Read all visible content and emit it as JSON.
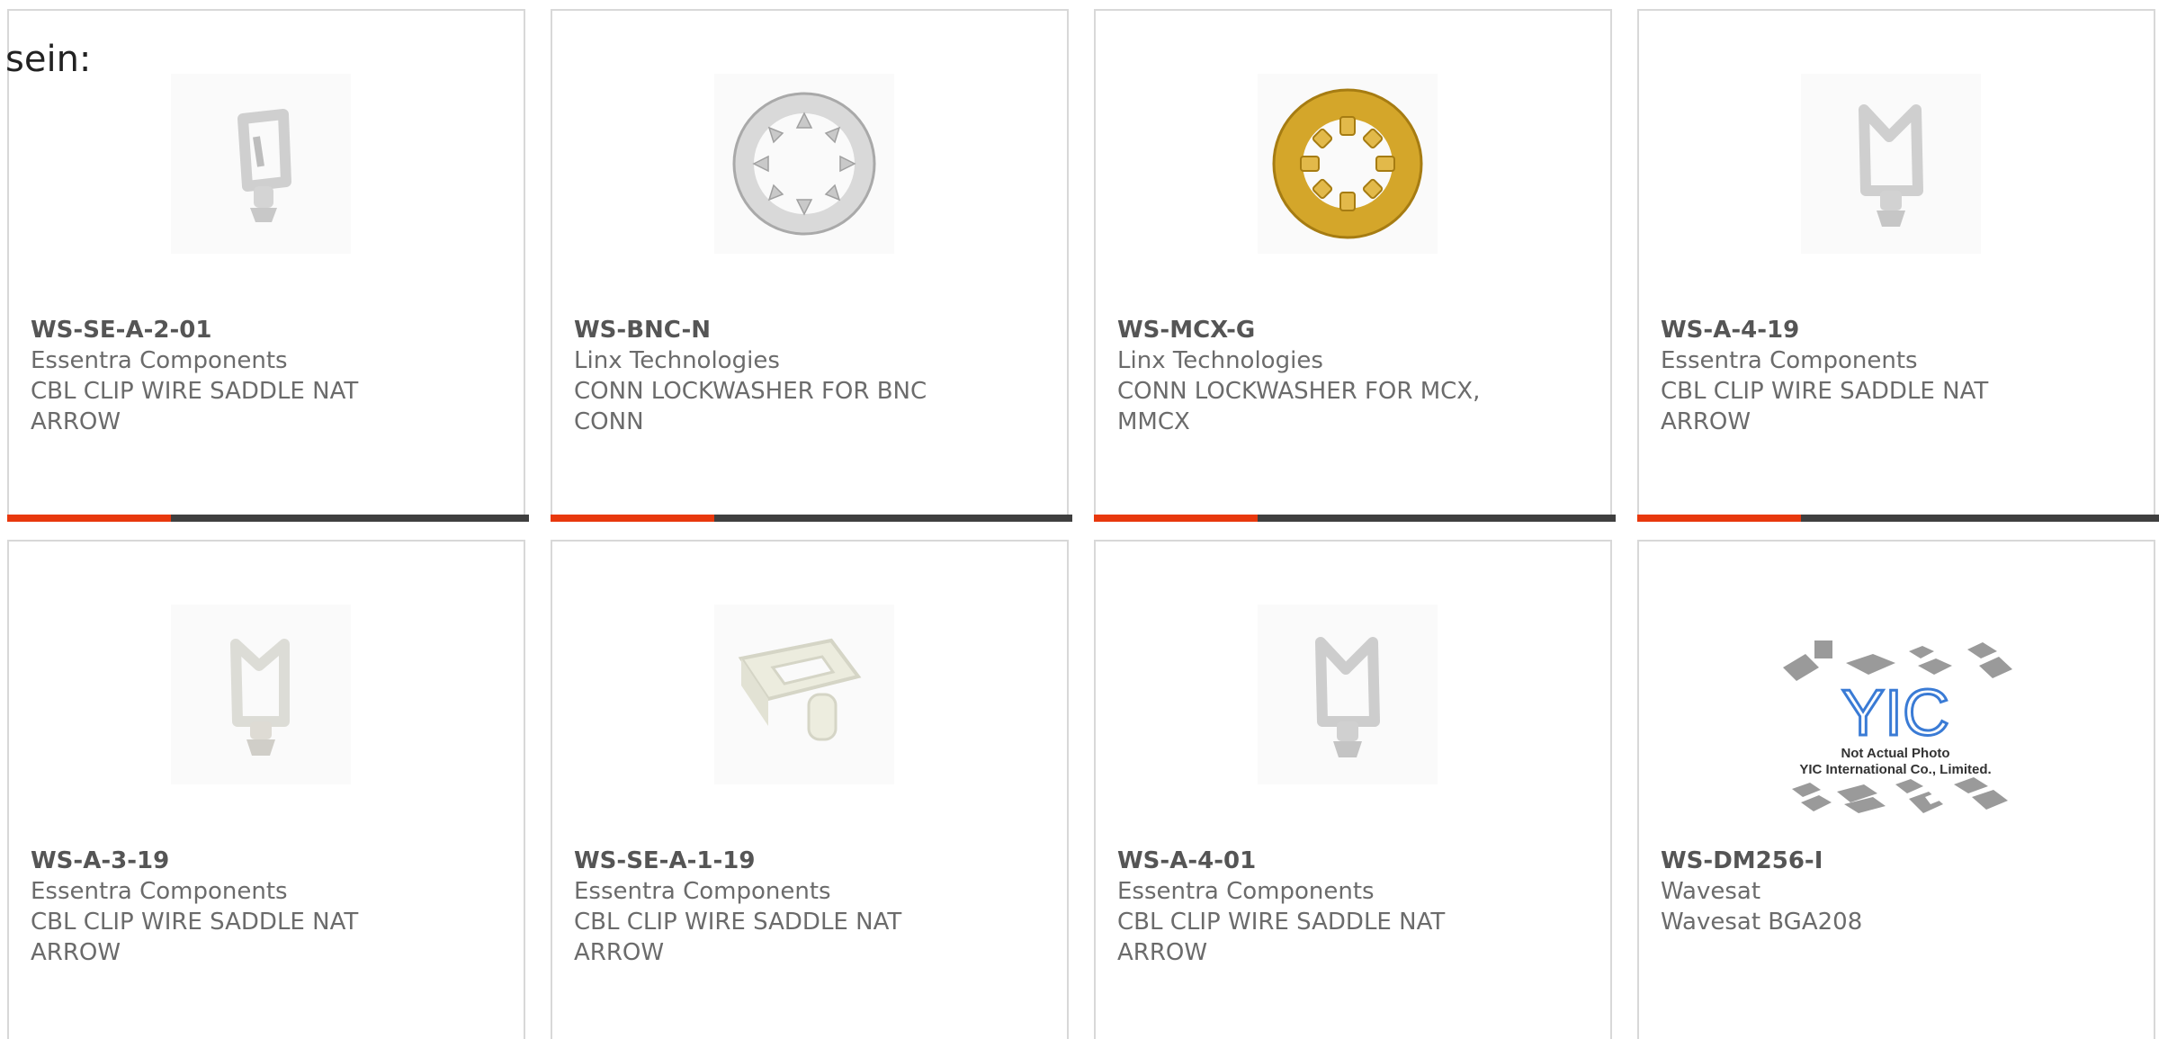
{
  "lead_text": "sein:",
  "colors": {
    "card_border": "#d8d8d8",
    "text_muted": "#6b6b6b",
    "bar_dark": "#3f3f3f",
    "bar_accent": "#e8380d"
  },
  "products": [
    {
      "part_number": "WS-SE-A-2-01",
      "manufacturer": "Essentra Components",
      "description": "CBL CLIP WIRE SADDLE NAT ARROW",
      "image_icon": "wire-saddle-clip-icon"
    },
    {
      "part_number": "WS-BNC-N",
      "manufacturer": "Linx Technologies",
      "description": "CONN LOCKWASHER FOR BNC CONN",
      "image_icon": "lockwasher-silver-icon"
    },
    {
      "part_number": "WS-MCX-G",
      "manufacturer": "Linx Technologies",
      "description": "CONN LOCKWASHER FOR MCX, MMCX",
      "image_icon": "lockwasher-gold-icon"
    },
    {
      "part_number": "WS-A-4-19",
      "manufacturer": "Essentra Components",
      "description": "CBL CLIP WIRE SADDLE NAT ARROW",
      "image_icon": "wire-saddle-clip-icon"
    },
    {
      "part_number": "WS-A-3-19",
      "manufacturer": "Essentra Components",
      "description": "CBL CLIP WIRE SADDLE NAT ARROW",
      "image_icon": "wire-saddle-clip-icon"
    },
    {
      "part_number": "WS-SE-A-1-19",
      "manufacturer": "Essentra Components",
      "description": "CBL CLIP WIRE SADDLE NAT ARROW",
      "image_icon": "wire-saddle-clip-icon"
    },
    {
      "part_number": "WS-A-4-01",
      "manufacturer": "Essentra Components",
      "description": "CBL CLIP WIRE SADDLE NAT ARROW",
      "image_icon": "wire-saddle-clip-icon"
    },
    {
      "part_number": "WS-DM256-I",
      "manufacturer": "Wavesat",
      "description": "Wavesat BGA208",
      "image_icon": "not-actual-photo-placeholder-icon",
      "image_caption_1": "Not Actual Photo",
      "image_caption_2": "YIC International Co., Limited.",
      "image_logo_text": "YIC"
    }
  ]
}
